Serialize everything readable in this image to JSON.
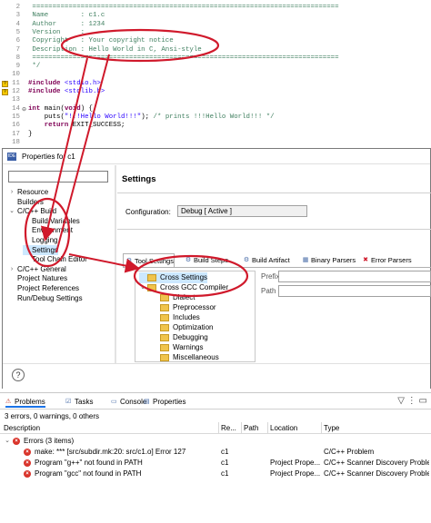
{
  "editor": {
    "lines": [
      {
        "num": "2",
        "fold": "",
        "parts": [
          {
            "c": "cmt",
            "t": " ============================================================================"
          }
        ]
      },
      {
        "num": "3",
        "fold": "",
        "parts": [
          {
            "c": "cmt",
            "t": " Name        : c1.c"
          }
        ]
      },
      {
        "num": "4",
        "fold": "",
        "parts": [
          {
            "c": "cmt",
            "t": " Author      : 1234"
          }
        ]
      },
      {
        "num": "5",
        "fold": "",
        "parts": [
          {
            "c": "cmt",
            "t": " Version     :"
          }
        ]
      },
      {
        "num": "6",
        "fold": "",
        "parts": [
          {
            "c": "cmt",
            "t": " Copyright   : Your copyright notice"
          }
        ]
      },
      {
        "num": "7",
        "fold": "",
        "parts": [
          {
            "c": "cmt",
            "t": " Description : Hello World in C, Ansi-style"
          }
        ]
      },
      {
        "num": "8",
        "fold": "",
        "parts": [
          {
            "c": "cmt",
            "t": " ============================================================================"
          }
        ]
      },
      {
        "num": "9",
        "fold": "",
        "parts": [
          {
            "c": "cmt",
            "t": " */"
          }
        ]
      },
      {
        "num": "10",
        "fold": "",
        "parts": [
          {
            "c": "",
            "t": ""
          }
        ]
      },
      {
        "num": "11",
        "fold": "",
        "warn": true,
        "parts": [
          {
            "c": "dirv",
            "t": "#include"
          },
          {
            "c": "",
            "t": " "
          },
          {
            "c": "str",
            "t": "<stdio.h>"
          }
        ]
      },
      {
        "num": "12",
        "fold": "",
        "warn": true,
        "parts": [
          {
            "c": "dirv",
            "t": "#include"
          },
          {
            "c": "",
            "t": " "
          },
          {
            "c": "str",
            "t": "<stdlib.h>"
          }
        ]
      },
      {
        "num": "13",
        "fold": "",
        "parts": [
          {
            "c": "",
            "t": ""
          }
        ]
      },
      {
        "num": "14",
        "fold": "⊖",
        "parts": [
          {
            "c": "kw",
            "t": "int"
          },
          {
            "c": "",
            "t": " main("
          },
          {
            "c": "kw",
            "t": "void"
          },
          {
            "c": "",
            "t": ") {"
          }
        ]
      },
      {
        "num": "15",
        "fold": "",
        "parts": [
          {
            "c": "",
            "t": "    puts("
          },
          {
            "c": "str",
            "t": "\"!!!Hello World!!!\""
          },
          {
            "c": "",
            "t": "); "
          },
          {
            "c": "cmt",
            "t": "/* prints !!!Hello World!!! */"
          }
        ]
      },
      {
        "num": "16",
        "fold": "",
        "parts": [
          {
            "c": "",
            "t": "    "
          },
          {
            "c": "kw",
            "t": "return"
          },
          {
            "c": "",
            "t": " EXIT_SUCCESS;"
          }
        ]
      },
      {
        "num": "17",
        "fold": "",
        "parts": [
          {
            "c": "",
            "t": "}"
          }
        ]
      },
      {
        "num": "18",
        "fold": "",
        "parts": [
          {
            "c": "",
            "t": ""
          }
        ]
      }
    ]
  },
  "dialog": {
    "title": "Properties for c1",
    "app_icon": "ide",
    "filter_placeholder": "",
    "tree": [
      {
        "label": "Resource",
        "twisty": "›",
        "indent": 0
      },
      {
        "label": "Builders",
        "twisty": "",
        "indent": 0
      },
      {
        "label": "C/C++ Build",
        "twisty": "⌄",
        "indent": 0
      },
      {
        "label": "Build Variables",
        "twisty": "",
        "indent": 1
      },
      {
        "label": "Environment",
        "twisty": "",
        "indent": 1
      },
      {
        "label": "Logging",
        "twisty": "",
        "indent": 1
      },
      {
        "label": "Settings",
        "twisty": "",
        "indent": 1,
        "selected": true
      },
      {
        "label": "Tool Chain Editor",
        "twisty": "",
        "indent": 1
      },
      {
        "label": "C/C++ General",
        "twisty": "›",
        "indent": 0
      },
      {
        "label": "Project Natures",
        "twisty": "",
        "indent": 0
      },
      {
        "label": "Project References",
        "twisty": "",
        "indent": 0
      },
      {
        "label": "Run/Debug Settings",
        "twisty": "",
        "indent": 0
      }
    ],
    "settings_title": "Settings",
    "config_label": "Configuration:",
    "config_value": "Debug  [ Active ]",
    "tabs": [
      {
        "label": "Tool Settings",
        "icon": "tool-settings-icon",
        "glyph": "⚙"
      },
      {
        "label": "Build Steps",
        "icon": "build-steps-icon",
        "glyph": "⚙"
      },
      {
        "label": "Build Artifact",
        "icon": "build-artifact-icon",
        "glyph": "⚙"
      },
      {
        "label": "Binary Parsers",
        "icon": "binary-parsers-icon",
        "glyph": "▦"
      },
      {
        "label": "Error Parsers",
        "icon": "error-parsers-icon",
        "glyph": "✖"
      }
    ],
    "tool_tree": [
      {
        "label": "Cross Settings",
        "indent": 0,
        "twisty": "",
        "selected": true
      },
      {
        "label": "Cross GCC Compiler",
        "indent": 0,
        "twisty": "⌄"
      },
      {
        "label": "Dialect",
        "indent": 1,
        "twisty": ""
      },
      {
        "label": "Preprocessor",
        "indent": 1,
        "twisty": ""
      },
      {
        "label": "Includes",
        "indent": 1,
        "twisty": ""
      },
      {
        "label": "Optimization",
        "indent": 1,
        "twisty": ""
      },
      {
        "label": "Debugging",
        "indent": 1,
        "twisty": ""
      },
      {
        "label": "Warnings",
        "indent": 1,
        "twisty": ""
      },
      {
        "label": "Miscellaneous",
        "indent": 1,
        "twisty": ""
      }
    ],
    "prefix_label": "Prefix",
    "path_label": "Path",
    "help_glyph": "?"
  },
  "problems": {
    "tabs": [
      {
        "label": "Problems",
        "glyph": "⚠",
        "active": true
      },
      {
        "label": "Tasks",
        "glyph": "☑"
      },
      {
        "label": "Console",
        "glyph": "▭"
      },
      {
        "label": "Properties",
        "glyph": "▤"
      }
    ],
    "tool_glyphs": "▽  ⋮  ▭",
    "summary": "3 errors, 0 warnings, 0 others",
    "columns": [
      "Description",
      "Re...",
      "Path",
      "Location",
      "Type"
    ],
    "group": {
      "label": "Errors (3 items)",
      "twisty": "⌄"
    },
    "rows": [
      {
        "description": "make: *** [src/subdir.mk:20: src/c1.o] Error 127",
        "resource": "c1",
        "path": "",
        "location": "",
        "type": "C/C++ Problem"
      },
      {
        "description": "Program \"g++\" not found in PATH",
        "resource": "c1",
        "path": "",
        "location": "Project Prope...",
        "type": "C/C++ Scanner Discovery Proble"
      },
      {
        "description": "Program \"gcc\" not found in PATH",
        "resource": "c1",
        "path": "",
        "location": "Project Prope...",
        "type": "C/C++ Scanner Discovery Proble"
      }
    ]
  },
  "colors": {
    "annotation_red": "#d0192b",
    "selection_blue": "#cce8ff",
    "comment_green": "#3f7f5f",
    "keyword_purple": "#7f0055",
    "string_blue": "#2a00ff"
  }
}
